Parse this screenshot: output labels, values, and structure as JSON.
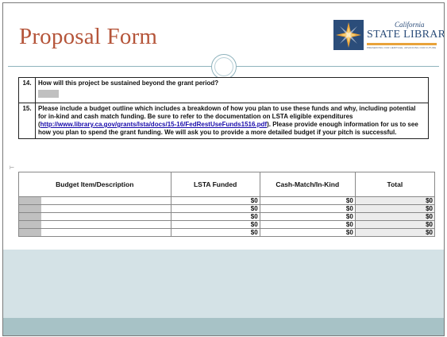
{
  "header": {
    "title": "Proposal Form",
    "logo": {
      "script_line": "California",
      "name": "STATE LIBRARY",
      "tagline": "PRESERVING OUR HERITAGE, ADVANCING OUR FUTURE"
    }
  },
  "questions": [
    {
      "number": "14.",
      "text": "How will this project be sustained beyond the grant period?"
    },
    {
      "number": "15.",
      "text_before_link": "Please include a budget outline which includes a breakdown of how you plan to use these funds and why, including potential for in-kind and cash match funding. Be sure to refer to the documentation on LSTA eligible expenditures (",
      "link": "http://www.library.ca.gov/grants/lsta/docs/15-16/FedRestUseFunds1516.pdf",
      "text_after_link": "). Please provide enough information for us to see how you plan to spend the grant funding. We will ask you to provide a more detailed budget if your pitch is successful."
    }
  ],
  "budget_table": {
    "headers": [
      "Budget Item/Description",
      "LSTA Funded",
      "Cash-Match/In-Kind",
      "Total"
    ],
    "rows": [
      [
        "",
        "$0",
        "$0",
        "$0"
      ],
      [
        "",
        "$0",
        "$0",
        "$0"
      ],
      [
        "",
        "$0",
        "$0",
        "$0"
      ],
      [
        "",
        "$0",
        "$0",
        "$0"
      ],
      [
        "",
        "$0",
        "$0",
        "$0"
      ]
    ]
  },
  "colors": {
    "title": "#b5553a",
    "logo_blue": "#2b4d7a",
    "logo_accent": "#e8a33a",
    "body_band": "#d4e2e6",
    "footer_band": "#a7c2c6",
    "link": "#1a0dab"
  }
}
